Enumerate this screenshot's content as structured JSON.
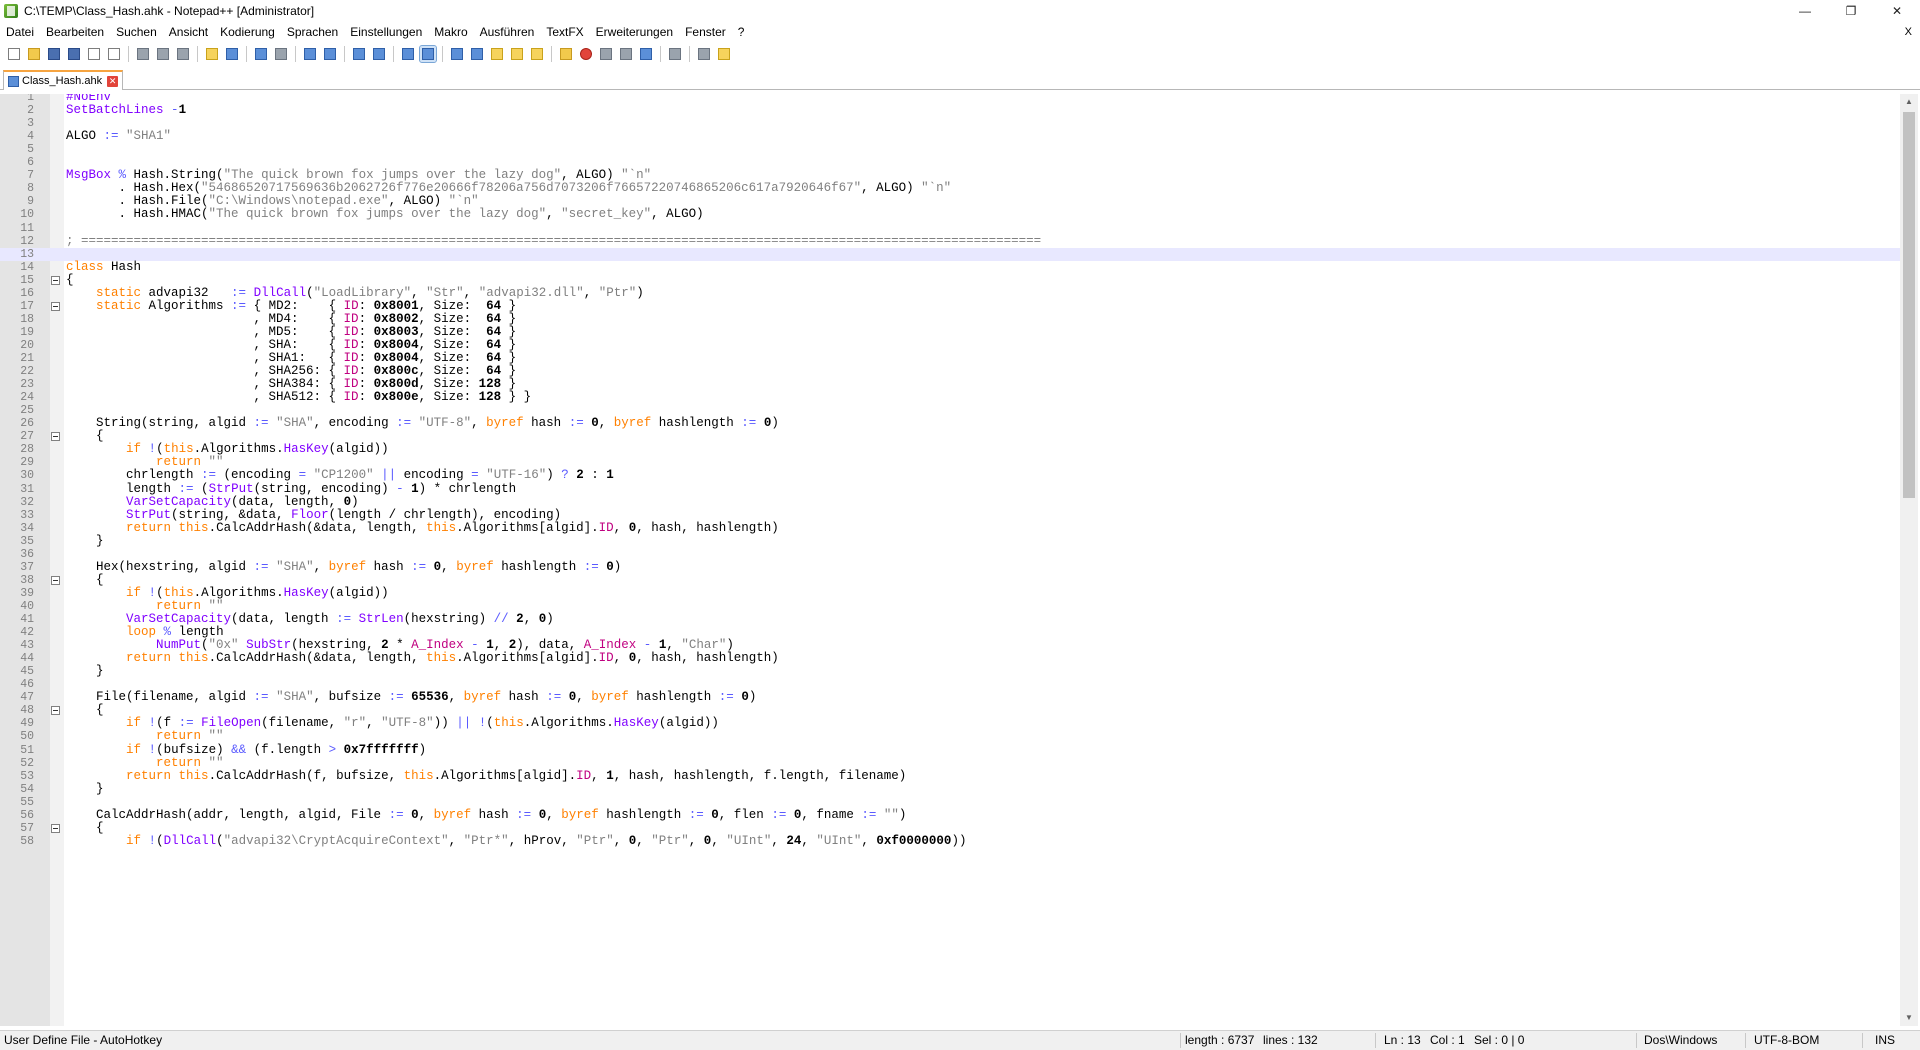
{
  "window": {
    "title": "C:\\TEMP\\Class_Hash.ahk - Notepad++ [Administrator]",
    "controls": {
      "minimize": "—",
      "maximize": "❐",
      "close": "✕"
    }
  },
  "menu": {
    "items": [
      "Datei",
      "Bearbeiten",
      "Suchen",
      "Ansicht",
      "Kodierung",
      "Sprachen",
      "Einstellungen",
      "Makro",
      "Ausführen",
      "TextFX",
      "Erweiterungen",
      "Fenster",
      "?"
    ],
    "close_doc": "X"
  },
  "toolbar": {
    "icons": [
      "new-file",
      "open-file",
      "save",
      "save-all",
      "close",
      "close-all",
      "print",
      "cut",
      "copy",
      "paste",
      "undo",
      "redo",
      "find",
      "replace",
      "zoom-in",
      "zoom-out",
      "sync-vertical",
      "sync-horizontal",
      "word-wrap",
      "show-all-characters",
      "indent-guide",
      "user-define-language",
      "document-map",
      "function-list",
      "folder-as-workspace",
      "record-macro",
      "stop-macro",
      "play-macro",
      "run-macro-multiple",
      "save-macro",
      "spell-check",
      "plugin"
    ]
  },
  "tab": {
    "label": "Class_Hash.ahk"
  },
  "editor": {
    "current_line": 13,
    "lines": [
      {
        "n": "1",
        "t": "#NoEnv"
      },
      {
        "n": "2",
        "t": "SetBatchLines -1"
      },
      {
        "n": "3",
        "t": ""
      },
      {
        "n": "4",
        "t": "ALGO := \"SHA1\""
      },
      {
        "n": "5",
        "t": ""
      },
      {
        "n": "6",
        "t": ""
      },
      {
        "n": "7",
        "t": "MsgBox % Hash.String(\"The quick brown fox jumps over the lazy dog\", ALGO) \"`n\""
      },
      {
        "n": "8",
        "t": "       . Hash.Hex(\"54686520717569636b2062726f776e20666f78206a756d7073206f76657220746865206c617a7920646f67\", ALGO) \"`n\""
      },
      {
        "n": "9",
        "t": "       . Hash.File(\"C:\\Windows\\notepad.exe\", ALGO) \"`n\""
      },
      {
        "n": "10",
        "t": "       . Hash.HMAC(\"The quick brown fox jumps over the lazy dog\", \"secret_key\", ALGO)"
      },
      {
        "n": "11",
        "t": ""
      },
      {
        "n": "12",
        "t": "; ================================================================================================================================"
      },
      {
        "n": "13",
        "t": ""
      },
      {
        "n": "14",
        "t": "class Hash"
      },
      {
        "n": "15",
        "t": "{"
      },
      {
        "n": "16",
        "t": "    static advapi32   := DllCall(\"LoadLibrary\", \"Str\", \"advapi32.dll\", \"Ptr\")"
      },
      {
        "n": "17",
        "t": "    static Algorithms := { MD2:    { ID: 0x8001, Size:  64 }"
      },
      {
        "n": "18",
        "t": "                         , MD4:    { ID: 0x8002, Size:  64 }"
      },
      {
        "n": "19",
        "t": "                         , MD5:    { ID: 0x8003, Size:  64 }"
      },
      {
        "n": "20",
        "t": "                         , SHA:    { ID: 0x8004, Size:  64 }"
      },
      {
        "n": "21",
        "t": "                         , SHA1:   { ID: 0x8004, Size:  64 }"
      },
      {
        "n": "22",
        "t": "                         , SHA256: { ID: 0x800c, Size:  64 }"
      },
      {
        "n": "23",
        "t": "                         , SHA384: { ID: 0x800d, Size: 128 }"
      },
      {
        "n": "24",
        "t": "                         , SHA512: { ID: 0x800e, Size: 128 } }"
      },
      {
        "n": "25",
        "t": ""
      },
      {
        "n": "26",
        "t": "    String(string, algid := \"SHA\", encoding := \"UTF-8\", byref hash := 0, byref hashlength := 0)"
      },
      {
        "n": "27",
        "t": "    {"
      },
      {
        "n": "28",
        "t": "        if !(this.Algorithms.HasKey(algid))"
      },
      {
        "n": "29",
        "t": "            return \"\""
      },
      {
        "n": "30",
        "t": "        chrlength := (encoding = \"CP1200\" || encoding = \"UTF-16\") ? 2 : 1"
      },
      {
        "n": "31",
        "t": "        length := (StrPut(string, encoding) - 1) * chrlength"
      },
      {
        "n": "32",
        "t": "        VarSetCapacity(data, length, 0)"
      },
      {
        "n": "33",
        "t": "        StrPut(string, &data, Floor(length / chrlength), encoding)"
      },
      {
        "n": "34",
        "t": "        return this.CalcAddrHash(&data, length, this.Algorithms[algid].ID, 0, hash, hashlength)"
      },
      {
        "n": "35",
        "t": "    }"
      },
      {
        "n": "36",
        "t": ""
      },
      {
        "n": "37",
        "t": "    Hex(hexstring, algid := \"SHA\", byref hash := 0, byref hashlength := 0)"
      },
      {
        "n": "38",
        "t": "    {"
      },
      {
        "n": "39",
        "t": "        if !(this.Algorithms.HasKey(algid))"
      },
      {
        "n": "40",
        "t": "            return \"\""
      },
      {
        "n": "41",
        "t": "        VarSetCapacity(data, length := StrLen(hexstring) // 2, 0)"
      },
      {
        "n": "42",
        "t": "        loop % length"
      },
      {
        "n": "43",
        "t": "            NumPut(\"0x\" SubStr(hexstring, 2 * A_Index - 1, 2), data, A_Index - 1, \"Char\")"
      },
      {
        "n": "44",
        "t": "        return this.CalcAddrHash(&data, length, this.Algorithms[algid].ID, 0, hash, hashlength)"
      },
      {
        "n": "45",
        "t": "    }"
      },
      {
        "n": "46",
        "t": ""
      },
      {
        "n": "47",
        "t": "    File(filename, algid := \"SHA\", bufsize := 65536, byref hash := 0, byref hashlength := 0)"
      },
      {
        "n": "48",
        "t": "    {"
      },
      {
        "n": "49",
        "t": "        if !(f := FileOpen(filename, \"r\", \"UTF-8\")) || !(this.Algorithms.HasKey(algid))"
      },
      {
        "n": "50",
        "t": "            return \"\""
      },
      {
        "n": "51",
        "t": "        if !(bufsize) && (f.length > 0x7fffffff)"
      },
      {
        "n": "52",
        "t": "            return \"\""
      },
      {
        "n": "53",
        "t": "        return this.CalcAddrHash(f, bufsize, this.Algorithms[algid].ID, 1, hash, hashlength, f.length, filename)"
      },
      {
        "n": "54",
        "t": "    }"
      },
      {
        "n": "55",
        "t": ""
      },
      {
        "n": "56",
        "t": "    CalcAddrHash(addr, length, algid, File := 0, byref hash := 0, byref hashlength := 0, flen := 0, fname := \"\")"
      },
      {
        "n": "57",
        "t": "    {"
      },
      {
        "n": "58",
        "t": "        if !(DllCall(\"advapi32\\CryptAcquireContext\", \"Ptr*\", hProv, \"Ptr\", 0, \"Ptr\", 0, \"UInt\", 24, \"UInt\", 0xf0000000))"
      }
    ],
    "fold_lines": [
      15,
      17,
      27,
      38,
      48,
      57
    ]
  },
  "status": {
    "language": "User Define File - AutoHotkey",
    "length": "length : 6737",
    "lines": "lines : 132",
    "ln": "Ln : 13",
    "col": "Col : 1",
    "sel": "Sel : 0 | 0",
    "eol": "Dos\\Windows",
    "encoding": "UTF-8-BOM",
    "mode": "INS"
  }
}
